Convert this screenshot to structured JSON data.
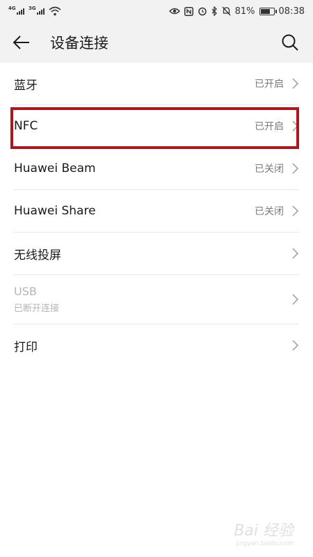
{
  "status_bar": {
    "signal1_tag": "4G",
    "signal2_tag": "3G",
    "battery_percent": "81%",
    "battery_level": 0.81,
    "time": "08:38"
  },
  "header": {
    "title": "设备连接",
    "back_icon": "arrow-left-icon",
    "search_icon": "search-icon"
  },
  "items": [
    {
      "label": "蓝牙",
      "value": "已开启"
    },
    {
      "label": "NFC",
      "value": "已开启"
    },
    {
      "label": "Huawei Beam",
      "value": "已关闭"
    },
    {
      "label": "Huawei Share",
      "value": "已关闭"
    },
    {
      "label": "无线投屏",
      "value": ""
    },
    {
      "label": "USB",
      "sublabel": "已断开连接",
      "value": ""
    },
    {
      "label": "打印",
      "value": ""
    }
  ],
  "colors": {
    "highlight": "#b0141d",
    "bar_background": "#f2f2f2"
  },
  "watermark": {
    "text": "Bai 经验",
    "url": "jingyan.baidu.com"
  }
}
